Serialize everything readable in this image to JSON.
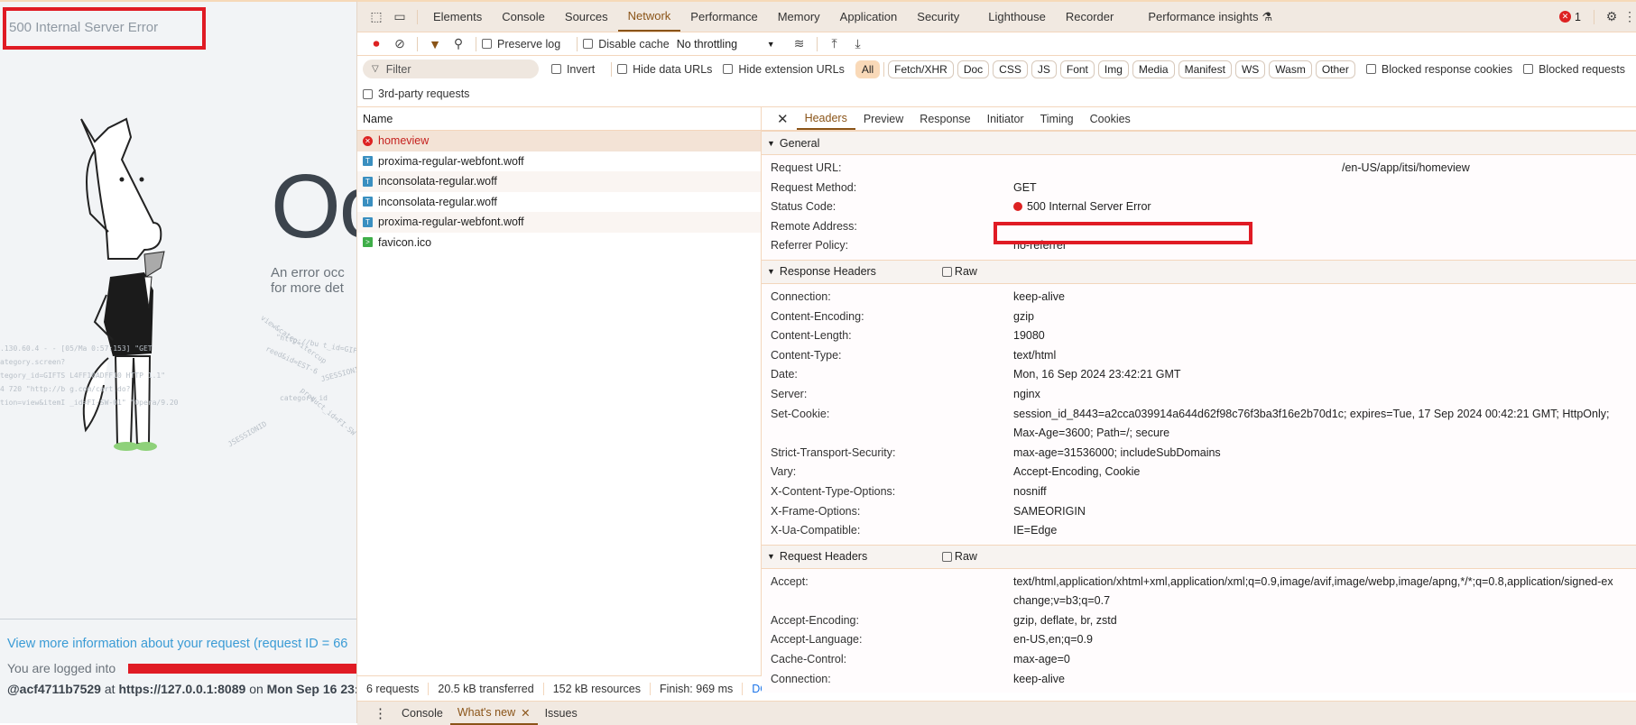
{
  "page": {
    "title": "500 Internal Server Error",
    "heading": "Oo",
    "error_line1": "An error occ",
    "error_line2": "for more det",
    "log_lines": [
      ".130.60.4 - - [05/Ma            0:57:153] \"GET",
      "ategory.screen?",
      "tegory_id=GIFTS              L4FF10ADFF10 HTTP 1.1\"",
      "4 720 \"http://b              g.com/cart.do?",
      "tion=view&itemI              _id=FI-SW-01\" \"Opera/9.20"
    ],
    "scatter_words": [
      "view&categ=itercup",
      "\"http://bu t_id=GIF",
      "reed&id=EST-6",
      "JSESSIONID",
      "category_id",
      "product_id=FI-SW",
      "JSESSIONID"
    ],
    "more_info_link": "View more information about your request (request ID = 66",
    "logged_prefix": "You are logged into",
    "logged_user": "@acf4711b7529",
    "logged_at": "at",
    "logged_url": "https://127.0.0.1:8089",
    "logged_on": "on",
    "logged_date": "Mon Sep 16 23:"
  },
  "devtools": {
    "tabs": [
      "Elements",
      "Console",
      "Sources",
      "Network",
      "Performance",
      "Memory",
      "Application",
      "Security",
      "Lighthouse",
      "Recorder",
      "Performance insights"
    ],
    "active_tab": "Network",
    "error_count": "1",
    "toolbar": {
      "preserve_log": "Preserve log",
      "disable_cache": "Disable cache",
      "throttling": "No throttling"
    },
    "filter": {
      "placeholder": "Filter",
      "invert": "Invert",
      "hide_data_urls": "Hide data URLs",
      "hide_extension_urls": "Hide extension URLs",
      "types": [
        "All",
        "Fetch/XHR",
        "Doc",
        "CSS",
        "JS",
        "Font",
        "Img",
        "Media",
        "Manifest",
        "WS",
        "Wasm",
        "Other"
      ],
      "blocked_cookies": "Blocked response cookies",
      "blocked_requests": "Blocked requests",
      "third_party": "3rd-party requests"
    },
    "list": {
      "header": "Name",
      "requests": [
        {
          "name": "homeview",
          "type": "error"
        },
        {
          "name": "proxima-regular-webfont.woff",
          "type": "font"
        },
        {
          "name": "inconsolata-regular.woff",
          "type": "font"
        },
        {
          "name": "inconsolata-regular.woff",
          "type": "font"
        },
        {
          "name": "proxima-regular-webfont.woff",
          "type": "font"
        },
        {
          "name": "favicon.ico",
          "type": "other"
        }
      ]
    },
    "detail_tabs": [
      "Headers",
      "Preview",
      "Response",
      "Initiator",
      "Timing",
      "Cookies"
    ],
    "general": {
      "title": "General",
      "request_url_label": "Request URL:",
      "request_url": "/en-US/app/itsi/homeview",
      "method_label": "Request Method:",
      "method": "GET",
      "status_label": "Status Code:",
      "status": "500 Internal Server Error",
      "remote_label": "Remote Address:",
      "referrer_label": "Referrer Policy:",
      "referrer": "no-referrer"
    },
    "response_headers": {
      "title": "Response Headers",
      "raw": "Raw",
      "rows": [
        [
          "Connection:",
          "keep-alive"
        ],
        [
          "Content-Encoding:",
          "gzip"
        ],
        [
          "Content-Length:",
          "19080"
        ],
        [
          "Content-Type:",
          "text/html"
        ],
        [
          "Date:",
          "Mon, 16 Sep 2024 23:42:21 GMT"
        ],
        [
          "Server:",
          "nginx"
        ],
        [
          "Set-Cookie:",
          "session_id_8443=a2cca039914a644d62f98c76f3ba3f16e2b70d1c; expires=Tue, 17 Sep 2024 00:42:21 GMT; HttpOnly; Max-Age=3600; Path=/; secure"
        ],
        [
          "Strict-Transport-Security:",
          "max-age=31536000; includeSubDomains"
        ],
        [
          "Vary:",
          "Accept-Encoding, Cookie"
        ],
        [
          "X-Content-Type-Options:",
          "nosniff"
        ],
        [
          "X-Frame-Options:",
          "SAMEORIGIN"
        ],
        [
          "X-Ua-Compatible:",
          "IE=Edge"
        ]
      ]
    },
    "request_headers": {
      "title": "Request Headers",
      "raw": "Raw",
      "rows": [
        [
          "Accept:",
          "text/html,application/xhtml+xml,application/xml;q=0.9,image/avif,image/webp,image/apng,*/*;q=0.8,application/signed-exchange;v=b3;q=0.7"
        ],
        [
          "Accept-Encoding:",
          "gzip, deflate, br, zstd"
        ],
        [
          "Accept-Language:",
          "en-US,en;q=0.9"
        ],
        [
          "Cache-Control:",
          "max-age=0"
        ],
        [
          "Connection:",
          "keep-alive"
        ]
      ]
    },
    "status_bar": [
      "6 requests",
      "20.5 kB transferred",
      "152 kB resources",
      "Finish: 969 ms",
      "DO"
    ],
    "drawer": {
      "tabs": [
        "Console",
        "What's new",
        "Issues"
      ],
      "active": "What's new"
    },
    "colors": {
      "accent": "#8a5418",
      "error": "#dd2222",
      "highlight_box": "#e01b24"
    }
  }
}
